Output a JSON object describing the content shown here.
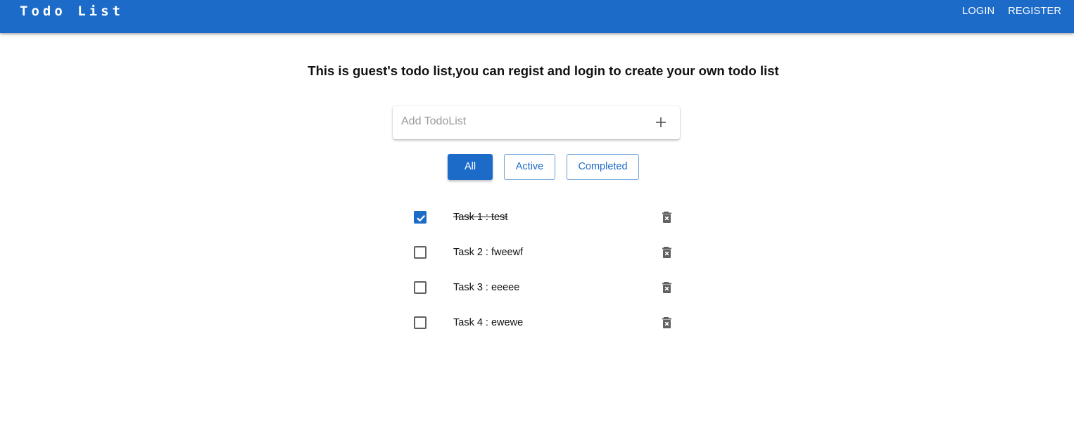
{
  "header": {
    "title": "Todo List",
    "nav": [
      "LOGIN",
      "REGISTER"
    ]
  },
  "headline": "This is guest's todo list,you can regist and login to create your own todo list",
  "add": {
    "placeholder": "Add TodoList",
    "button_icon": "plus-icon"
  },
  "filters": [
    {
      "label": "All",
      "selected": true
    },
    {
      "label": "Active",
      "selected": false
    },
    {
      "label": "Completed",
      "selected": false
    }
  ],
  "todos": [
    {
      "text": "Task 1 : test",
      "completed": true
    },
    {
      "text": "Task 2 : fweewf",
      "completed": false
    },
    {
      "text": "Task 3 : eeeee",
      "completed": false
    },
    {
      "text": "Task 4 : ewewe",
      "completed": false
    }
  ],
  "icons": {
    "checkbox": "checkbox-icon",
    "delete": "delete-forever-icon"
  },
  "colors": {
    "primary": "#1d6bc9",
    "text": "#111111",
    "icon": "#616161",
    "placeholder": "#9a9a9a"
  }
}
